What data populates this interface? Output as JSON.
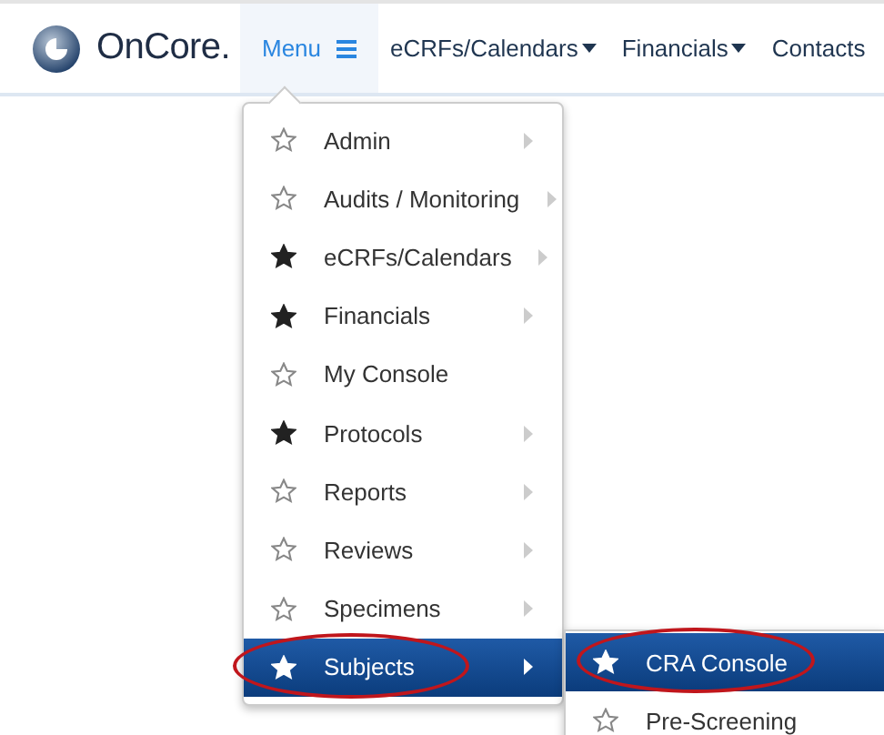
{
  "brand": {
    "name": "OnCore."
  },
  "nav": [
    {
      "label": "Menu",
      "kind": "menu",
      "selected": true
    },
    {
      "label": "eCRFs/Calendars",
      "kind": "dropdown",
      "selected": false
    },
    {
      "label": "Financials",
      "kind": "dropdown",
      "selected": false
    },
    {
      "label": "Contacts",
      "kind": "link",
      "selected": false
    }
  ],
  "menu": [
    {
      "label": "Admin",
      "favorite": false,
      "submenu": true,
      "selected": false,
      "circled": false
    },
    {
      "label": "Audits / Monitoring",
      "favorite": false,
      "submenu": true,
      "selected": false,
      "circled": false
    },
    {
      "label": "eCRFs/Calendars",
      "favorite": true,
      "submenu": true,
      "selected": false,
      "circled": false
    },
    {
      "label": "Financials",
      "favorite": true,
      "submenu": true,
      "selected": false,
      "circled": false
    },
    {
      "label": "My Console",
      "favorite": false,
      "submenu": false,
      "selected": false,
      "circled": false
    },
    {
      "label": "Protocols",
      "favorite": true,
      "submenu": true,
      "selected": false,
      "circled": false
    },
    {
      "label": "Reports",
      "favorite": false,
      "submenu": true,
      "selected": false,
      "circled": false
    },
    {
      "label": "Reviews",
      "favorite": false,
      "submenu": true,
      "selected": false,
      "circled": false
    },
    {
      "label": "Specimens",
      "favorite": false,
      "submenu": true,
      "selected": false,
      "circled": false
    },
    {
      "label": "Subjects",
      "favorite": true,
      "submenu": true,
      "selected": true,
      "circled": true
    }
  ],
  "submenu": [
    {
      "label": "CRA Console",
      "favorite": true,
      "submenu": false,
      "selected": true,
      "circled": true
    },
    {
      "label": "Pre-Screening",
      "favorite": false,
      "submenu": false,
      "selected": false,
      "circled": false
    }
  ]
}
